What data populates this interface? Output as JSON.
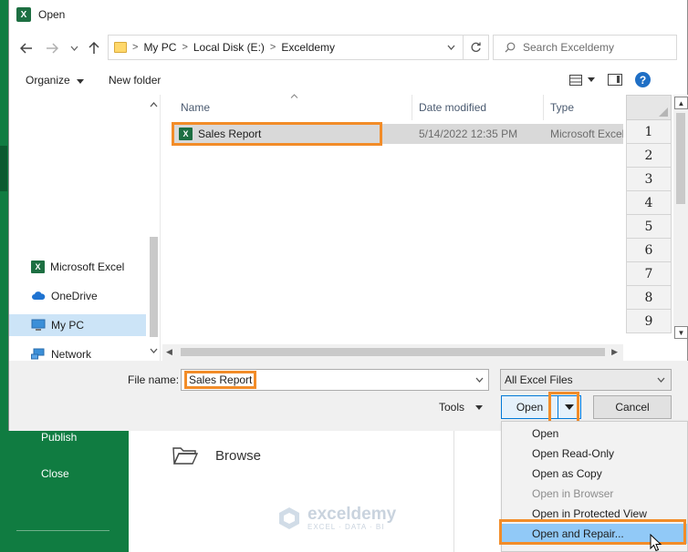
{
  "dialog": {
    "title": "Open",
    "app_badge": "X"
  },
  "nav": {
    "back_icon": "arrow-left-icon",
    "forward_icon": "arrow-right-icon",
    "history_icon": "chevron-down-icon",
    "up_icon": "arrow-up-icon"
  },
  "address": {
    "crumbs": [
      "My PC",
      "Local Disk (E:)",
      "Exceldemy"
    ],
    "separator": ">"
  },
  "search": {
    "placeholder": "Search Exceldemy"
  },
  "toolbar": {
    "organize_label": "Organize",
    "new_folder_label": "New folder"
  },
  "sidebar": {
    "items": [
      {
        "label": "Microsoft Excel",
        "icon": "excel-icon"
      },
      {
        "label": "OneDrive",
        "icon": "cloud-icon"
      },
      {
        "label": "My PC",
        "icon": "computer-icon",
        "selected": true
      },
      {
        "label": "Network",
        "icon": "network-icon"
      }
    ]
  },
  "filelist": {
    "columns": [
      "Name",
      "Date modified",
      "Type"
    ],
    "files": [
      {
        "name": "Sales Report",
        "date": "5/14/2022 12:35 PM",
        "type": "Microsoft Excel"
      }
    ]
  },
  "sheet": {
    "row_numbers": [
      "1",
      "2",
      "3",
      "4",
      "5",
      "6",
      "7",
      "8",
      "9"
    ]
  },
  "bottom": {
    "file_name_label": "File name:",
    "file_name_value": "Sales Report",
    "file_type_value": "All Excel Files",
    "tools_label": "Tools",
    "open_label": "Open",
    "cancel_label": "Cancel"
  },
  "open_menu": {
    "items": [
      {
        "label": "Open",
        "enabled": true
      },
      {
        "label": "Open Read-Only",
        "enabled": true
      },
      {
        "label": "Open as Copy",
        "enabled": true
      },
      {
        "label": "Open in Browser",
        "enabled": false
      },
      {
        "label": "Open in Protected View",
        "enabled": true
      },
      {
        "label": "Open and Repair...",
        "enabled": true,
        "hovered": true
      }
    ]
  },
  "backstage": {
    "items": [
      "Publish",
      "Close"
    ],
    "browse_label": "Browse"
  },
  "watermark": {
    "name": "exceldemy",
    "tagline": "EXCEL · DATA · BI"
  },
  "colors": {
    "excel_green": "#107c41",
    "highlight_orange": "#f28c28",
    "selection_blue": "#cce4f7",
    "menu_hover": "#91c9f7"
  }
}
